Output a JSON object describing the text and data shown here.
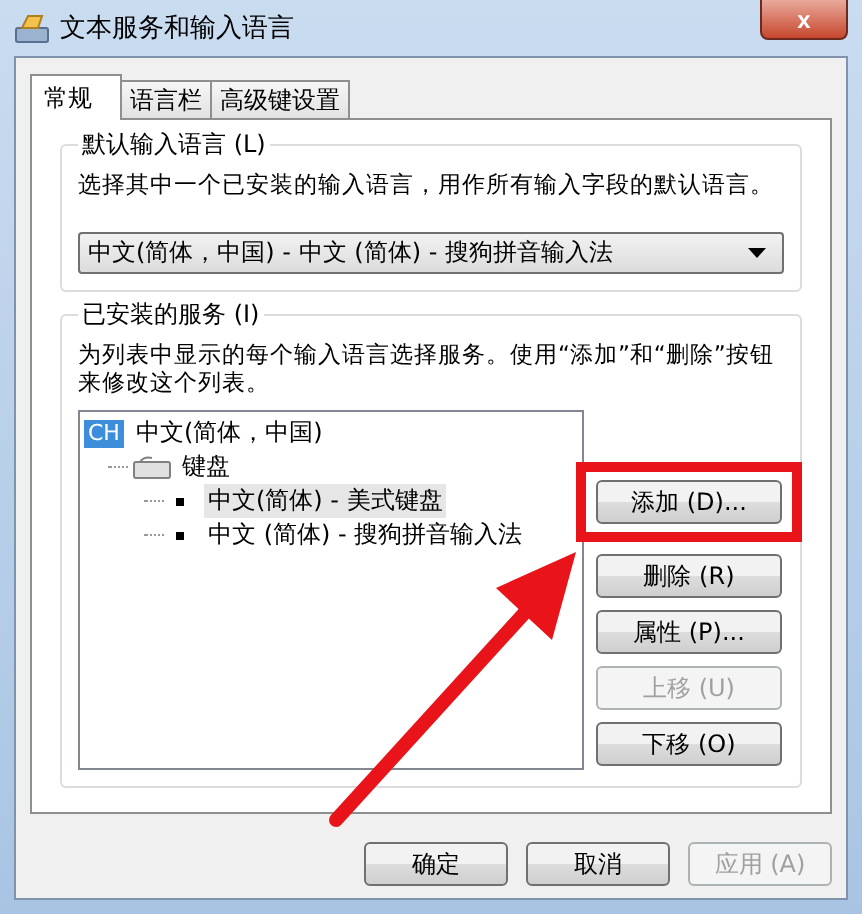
{
  "window": {
    "title": "文本服务和输入语言",
    "close": "x"
  },
  "tabs": [
    {
      "label": "常规",
      "selected": true
    },
    {
      "label": "语言栏",
      "selected": false
    },
    {
      "label": "高级键设置",
      "selected": false
    }
  ],
  "default_language": {
    "title": "默认输入语言 (L)",
    "description": "选择其中一个已安装的输入语言，用作所有输入字段的默认语言。",
    "value": "中文(简体，中国) - 中文 (简体) - 搜狗拼音输入法"
  },
  "installed_services": {
    "title": "已安装的服务 (I)",
    "description": "为列表中显示的每个输入语言选择服务。使用“添加”和“删除”按钮来修改这个列表。",
    "tree": [
      {
        "kind": "language",
        "badge": "CH",
        "label": "中文(简体，中国)",
        "selected": false,
        "children": [
          {
            "kind": "category",
            "label": "键盘",
            "selected": false,
            "children": [
              {
                "kind": "service",
                "label": "中文(简体) - 美式键盘",
                "selected": true
              },
              {
                "kind": "service",
                "label": "中文 (简体) - 搜狗拼音输入法",
                "selected": false
              }
            ]
          }
        ]
      }
    ],
    "buttons": [
      {
        "label": "添加 (D)...",
        "disabled": false,
        "highlighted": true
      },
      {
        "label": "删除 (R)",
        "disabled": false,
        "highlighted": false
      },
      {
        "label": "属性 (P)...",
        "disabled": false,
        "highlighted": false
      },
      {
        "label": "上移 (U)",
        "disabled": true,
        "highlighted": false
      },
      {
        "label": "下移 (O)",
        "disabled": false,
        "highlighted": false
      }
    ]
  },
  "footer_buttons": [
    {
      "label": "确定",
      "disabled": false
    },
    {
      "label": "取消",
      "disabled": false
    },
    {
      "label": "应用 (A)",
      "disabled": true
    }
  ]
}
